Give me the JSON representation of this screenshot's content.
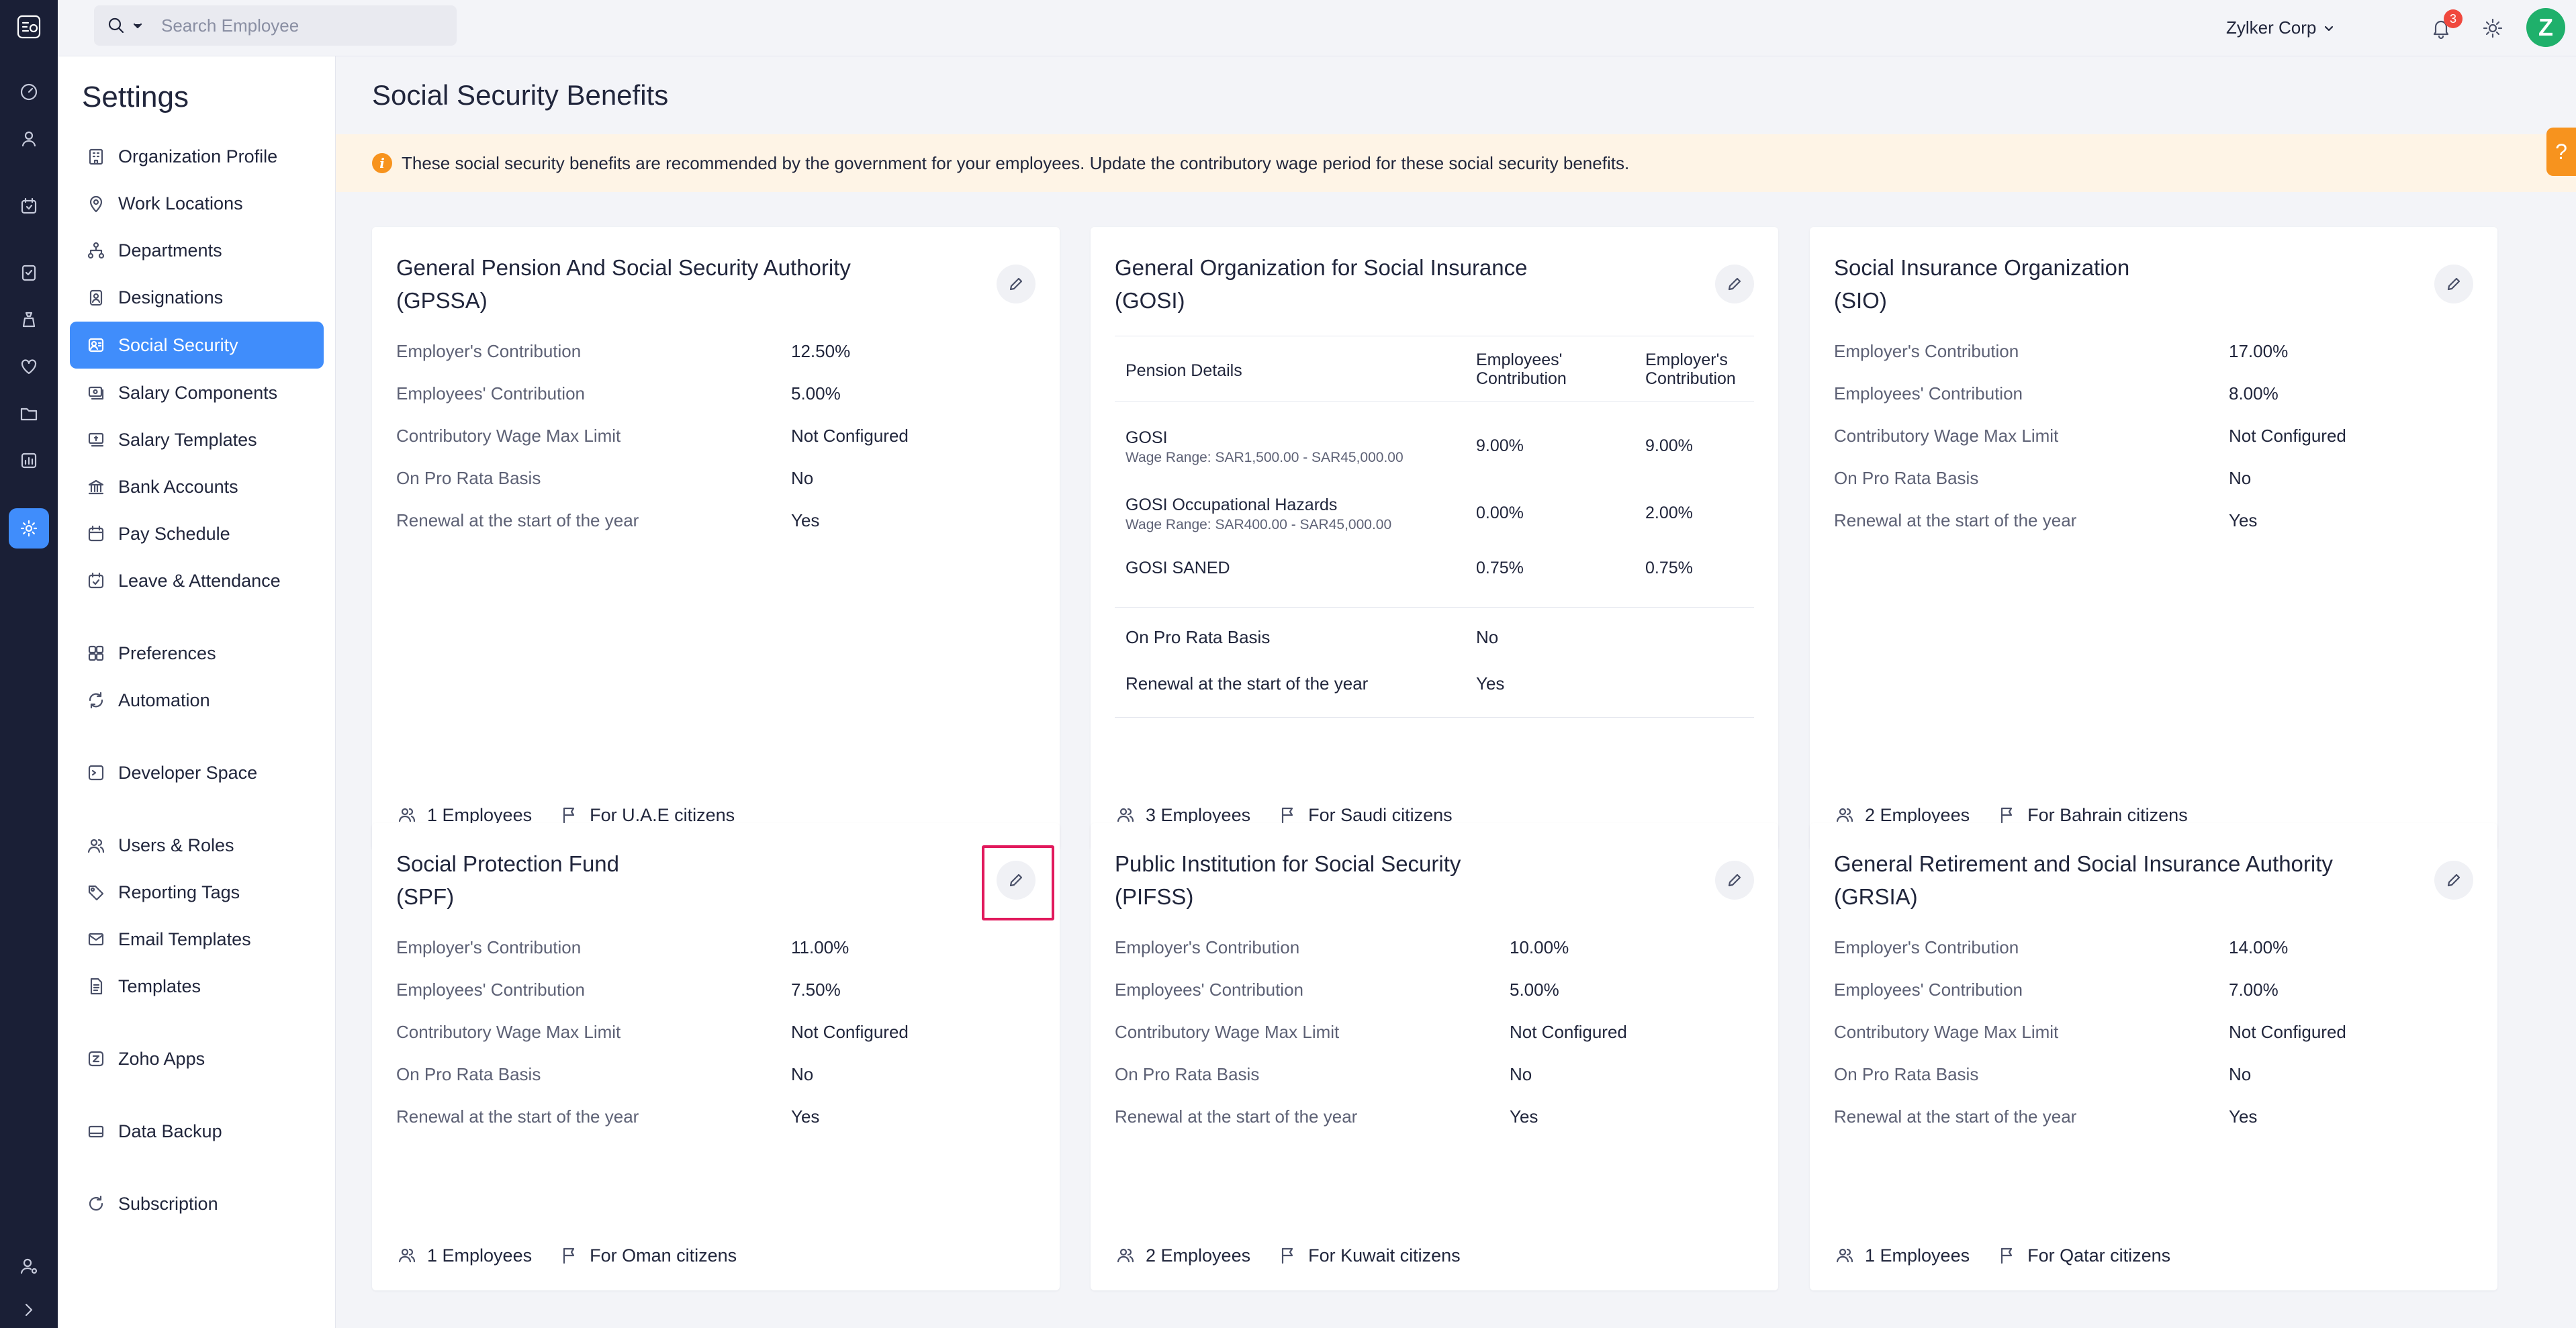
{
  "search": {
    "placeholder": "Search Employee"
  },
  "header": {
    "org_name": "Zylker Corp",
    "notification_count": "3",
    "avatar_initial": "Z"
  },
  "sidebar": {
    "title": "Settings",
    "items": [
      {
        "label": "Organization Profile",
        "icon": "building-icon"
      },
      {
        "label": "Work Locations",
        "icon": "location-pin-icon"
      },
      {
        "label": "Departments",
        "icon": "org-chart-icon"
      },
      {
        "label": "Designations",
        "icon": "id-badge-icon"
      },
      {
        "label": "Social Security",
        "icon": "social-security-icon",
        "active": true
      },
      {
        "label": "Salary Components",
        "icon": "salary-components-icon"
      },
      {
        "label": "Salary Templates",
        "icon": "salary-templates-icon"
      },
      {
        "label": "Bank Accounts",
        "icon": "bank-icon"
      },
      {
        "label": "Pay Schedule",
        "icon": "calendar-icon"
      },
      {
        "label": "Leave & Attendance",
        "icon": "leave-icon"
      },
      {
        "label": "Preferences",
        "icon": "preferences-icon"
      },
      {
        "label": "Automation",
        "icon": "automation-icon"
      },
      {
        "label": "Developer Space",
        "icon": "developer-icon"
      },
      {
        "label": "Users & Roles",
        "icon": "users-icon"
      },
      {
        "label": "Reporting Tags",
        "icon": "tag-icon"
      },
      {
        "label": "Email Templates",
        "icon": "email-icon"
      },
      {
        "label": "Templates",
        "icon": "document-icon"
      },
      {
        "label": "Zoho Apps",
        "icon": "zoho-apps-icon"
      },
      {
        "label": "Data Backup",
        "icon": "backup-icon"
      },
      {
        "label": "Subscription",
        "icon": "subscription-icon"
      }
    ]
  },
  "page": {
    "title": "Social Security Benefits",
    "banner": "These social security benefits are recommended by the government for your employees. Update the contributory wage period for these social security benefits.",
    "help_label": "?"
  },
  "labels": {
    "employer_contribution": "Employer's Contribution",
    "employees_contribution": "Employees' Contribution",
    "wage_max_limit": "Contributory Wage Max Limit",
    "pro_rata": "On Pro Rata Basis",
    "renewal": "Renewal at the start of the year"
  },
  "cards": [
    {
      "title_line1": "General Pension And Social Security Authority",
      "title_line2": "(GPSSA)",
      "employer": "12.50%",
      "employees": "5.00%",
      "wage_limit": "Not Configured",
      "pro_rata": "No",
      "renewal": "Yes",
      "employee_count": "1 Employees",
      "citizens": "For U.A.E citizens"
    },
    {
      "title_line1": "General Organization for Social Insurance",
      "title_line2": "(GOSI)",
      "employee_count": "3 Employees",
      "citizens": "For Saudi citizens",
      "table": {
        "headers": {
          "pension_details": "Pension Details",
          "employees_line1": "Employees'",
          "employees_line2": "Contribution",
          "employer_line1": "Employer's",
          "employer_line2": "Contribution"
        },
        "rows": [
          {
            "name": "GOSI",
            "range": "Wage Range: SAR1,500.00 - SAR45,000.00",
            "employees": "9.00%",
            "employer": "9.00%"
          },
          {
            "name": "GOSI Occupational Hazards",
            "range": "Wage Range: SAR400.00 - SAR45,000.00",
            "employees": "0.00%",
            "employer": "2.00%"
          },
          {
            "name": "GOSI SANED",
            "range": "",
            "employees": "0.75%",
            "employer": "0.75%"
          }
        ],
        "pro_rata_label": "On Pro Rata Basis",
        "pro_rata": "No",
        "renewal_label": "Renewal at the start of the year",
        "renewal": "Yes"
      }
    },
    {
      "title_line1": "Social Insurance Organization",
      "title_line2": "(SIO)",
      "employer": "17.00%",
      "employees": "8.00%",
      "wage_limit": "Not Configured",
      "pro_rata": "No",
      "renewal": "Yes",
      "employee_count": "2 Employees",
      "citizens": "For Bahrain citizens"
    },
    {
      "title_line1": "Social Protection Fund",
      "title_line2": "(SPF)",
      "employer": "11.00%",
      "employees": "7.50%",
      "wage_limit": "Not Configured",
      "pro_rata": "No",
      "renewal": "Yes",
      "employee_count": "1 Employees",
      "citizens": "For Oman citizens"
    },
    {
      "title_line1": "Public Institution for Social Security",
      "title_line2": "(PIFSS)",
      "employer": "10.00%",
      "employees": "5.00%",
      "wage_limit": "Not Configured",
      "pro_rata": "No",
      "renewal": "Yes",
      "employee_count": "2 Employees",
      "citizens": "For Kuwait citizens"
    },
    {
      "title_line1": "General Retirement and Social Insurance Authority",
      "title_line2": "(GRSIA)",
      "employer": "14.00%",
      "employees": "7.00%",
      "wage_limit": "Not Configured",
      "pro_rata": "No",
      "renewal": "Yes",
      "employee_count": "1 Employees",
      "citizens": "For Qatar citizens"
    }
  ]
}
